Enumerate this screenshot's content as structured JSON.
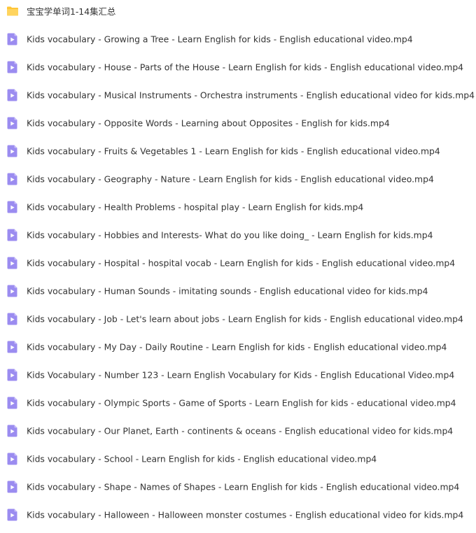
{
  "folder": {
    "name": "宝宝学单词1-14集汇总",
    "icon": "folder-icon",
    "icon_color": "#ffc536"
  },
  "files": [
    {
      "name": "Kids vocabulary - Growing a Tree - Learn English for kids - English educational video.mp4",
      "icon": "video-file-icon"
    },
    {
      "name": "Kids vocabulary - House - Parts of the House - Learn English for kids - English educational video.mp4",
      "icon": "video-file-icon"
    },
    {
      "name": "Kids vocabulary - Musical Instruments - Orchestra instruments - English educational video for kids.mp4",
      "icon": "video-file-icon"
    },
    {
      "name": "Kids vocabulary - Opposite Words - Learning about Opposites - English for kids.mp4",
      "icon": "video-file-icon"
    },
    {
      "name": "Kids vocabulary - Fruits & Vegetables 1 - Learn English for kids - English educational video.mp4",
      "icon": "video-file-icon"
    },
    {
      "name": "Kids vocabulary - Geography - Nature - Learn English for kids - English educational video.mp4",
      "icon": "video-file-icon"
    },
    {
      "name": "Kids vocabulary - Health Problems - hospital play - Learn English for kids.mp4",
      "icon": "video-file-icon"
    },
    {
      "name": "Kids vocabulary - Hobbies and Interests- What do you like doing_ - Learn English for kids.mp4",
      "icon": "video-file-icon"
    },
    {
      "name": "Kids vocabulary - Hospital - hospital vocab - Learn English for kids - English educational video.mp4",
      "icon": "video-file-icon"
    },
    {
      "name": "Kids vocabulary - Human Sounds - imitating sounds - English educational video for kids.mp4",
      "icon": "video-file-icon"
    },
    {
      "name": "Kids vocabulary - Job - Let's learn about jobs - Learn English for kids - English educational video.mp4",
      "icon": "video-file-icon"
    },
    {
      "name": "Kids vocabulary - My Day - Daily Routine - Learn English for kids - English educational video.mp4",
      "icon": "video-file-icon"
    },
    {
      "name": "Kids Vocabulary - Number 123 - Learn English Vocabulary for Kids - English Educational Video.mp4",
      "icon": "video-file-icon"
    },
    {
      "name": "Kids vocabulary - Olympic Sports - Game of Sports - Learn English for kids - educational video.mp4",
      "icon": "video-file-icon"
    },
    {
      "name": "Kids vocabulary - Our Planet, Earth - continents & oceans - English educational video for kids.mp4",
      "icon": "video-file-icon"
    },
    {
      "name": "Kids vocabulary - School - Learn English for kids - English educational video.mp4",
      "icon": "video-file-icon"
    },
    {
      "name": "Kids vocabulary - Shape - Names of Shapes - Learn English for kids - English educational video.mp4",
      "icon": "video-file-icon"
    },
    {
      "name": "Kids vocabulary - Halloween - Halloween monster costumes - English educational video for kids.mp4",
      "icon": "video-file-icon"
    }
  ],
  "colors": {
    "video_icon": "#9b8cf0",
    "video_icon_fold": "#c8bff8",
    "text": "#333333"
  }
}
